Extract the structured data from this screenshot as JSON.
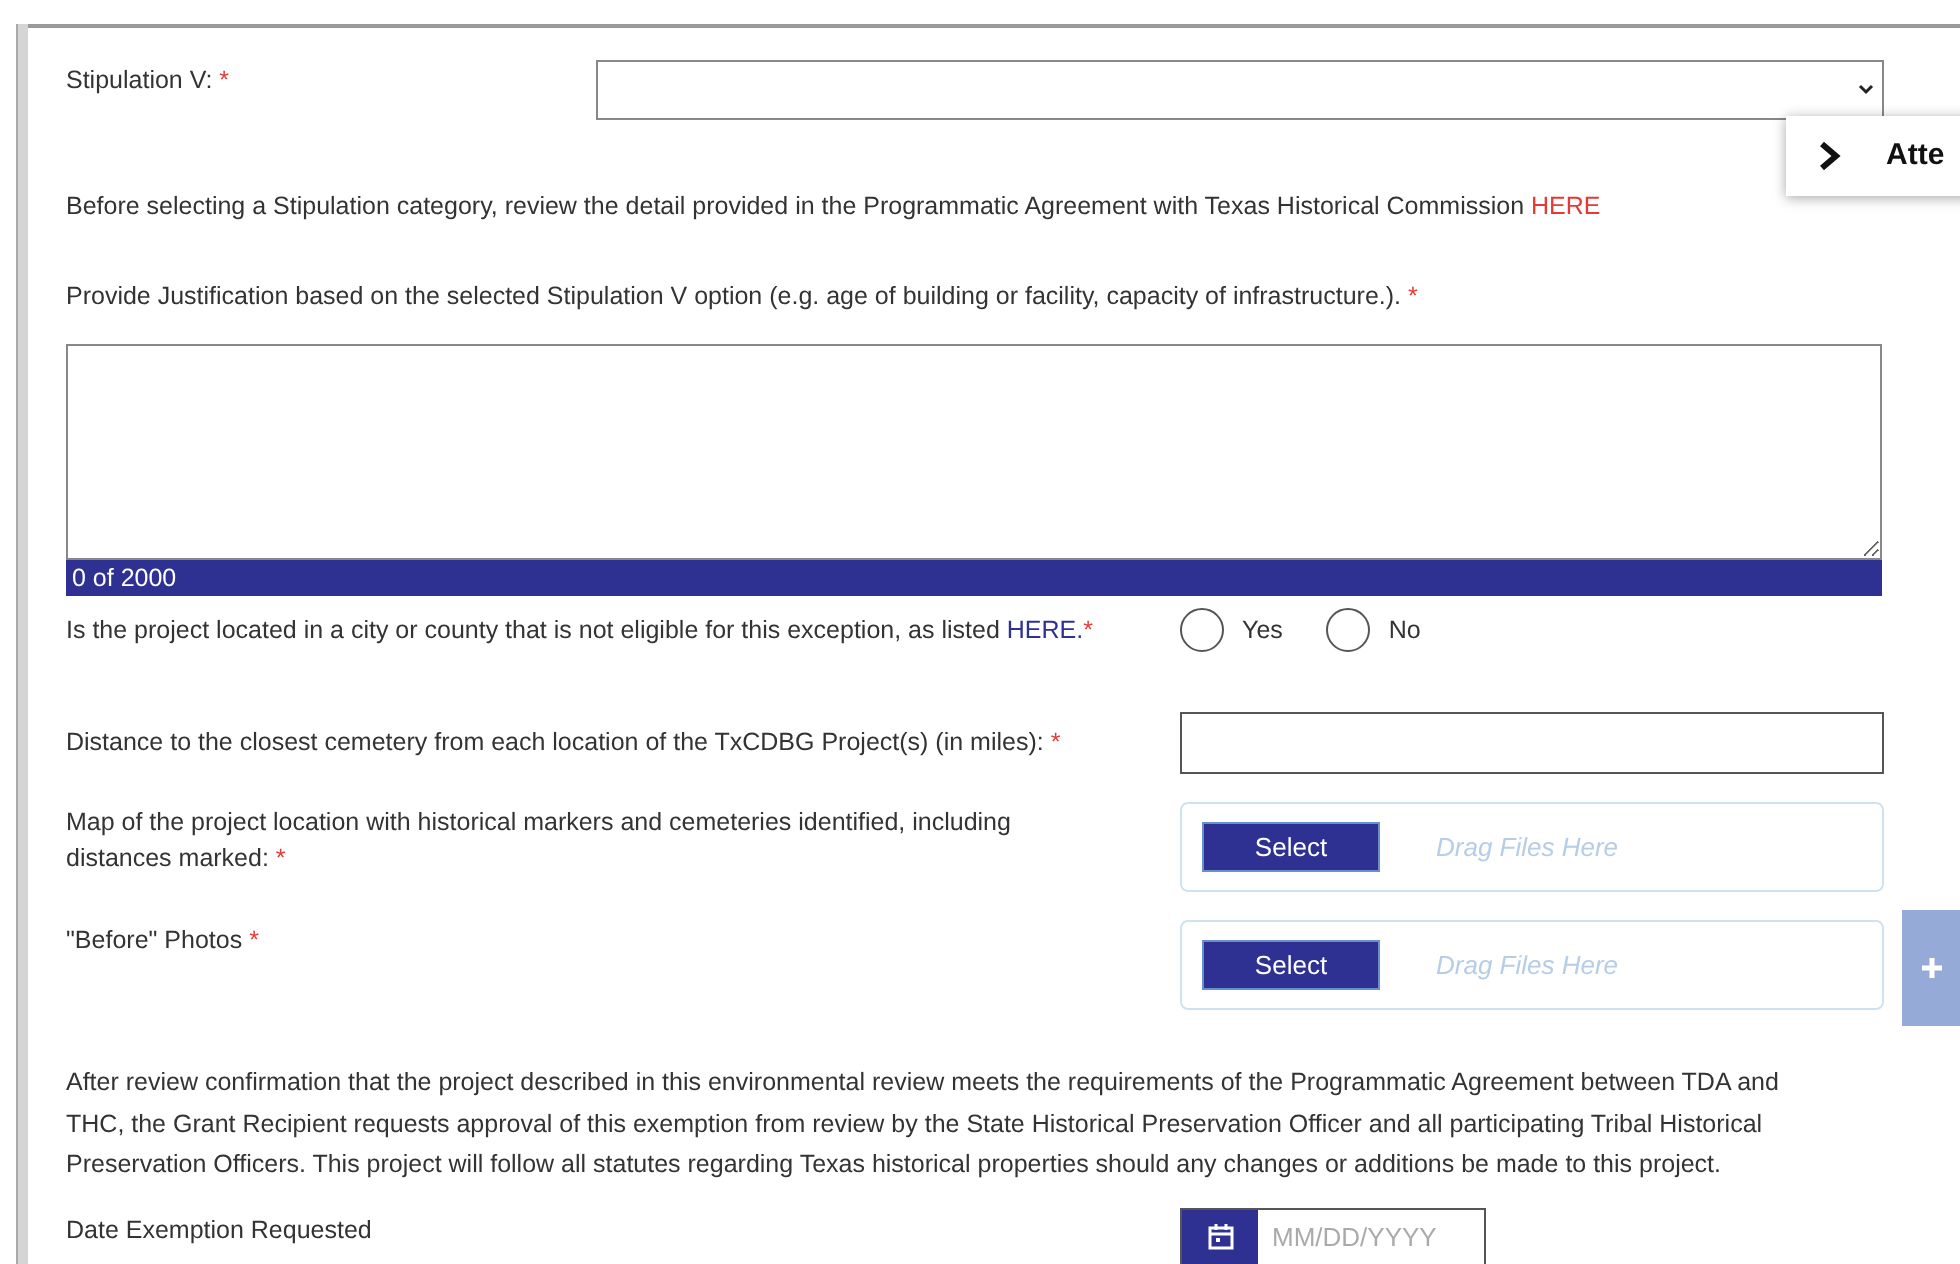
{
  "stipulation": {
    "label": "Stipulation V:",
    "required_mark": "*"
  },
  "review_note": {
    "text": "Before selecting a Stipulation category, review the detail provided in the Programmatic Agreement with Texas Historical Commission",
    "link": "HERE"
  },
  "justification": {
    "label": "Provide Justification based on the selected Stipulation V option (e.g. age of building or facility, capacity of infrastructure.).",
    "required_mark": "*",
    "counter": "0 of 2000"
  },
  "ineligible_question": {
    "label": "Is the project located in a city or county that is not eligible for this exception, as listed",
    "link": "HERE.",
    "required_mark": "*",
    "options": [
      {
        "label": "Yes",
        "selected": false
      },
      {
        "label": "No",
        "selected": false
      }
    ]
  },
  "cemetery_distance": {
    "label": "Distance to the closest cemetery from each location of the TxCDBG Project(s) (in miles):",
    "required_mark": "*"
  },
  "uploads": [
    {
      "label": "Map of the project location with historical markers and cemeteries identified, including distances marked:",
      "required_mark": "*",
      "button": "Select",
      "placeholder": "Drag Files Here"
    },
    {
      "label": "\"Before\" Photos",
      "required_mark": "*",
      "button": "Select",
      "placeholder": "Drag Files Here"
    }
  ],
  "certification": "After review confirmation that the project described in this environmental review meets the requirements of the Programmatic Agreement between TDA and THC, the Grant Recipient requests approval of this exemption from review by the State Historical Preservation Officer and all participating Tribal Historical Preservation Officers. This project will follow all statutes regarding Texas historical properties should any changes or additions be made to this project.",
  "date_requested": {
    "label": "Date Exemption Requested",
    "placeholder": "MM/DD/YYYY"
  },
  "side_panel": {
    "label": "Atte"
  }
}
